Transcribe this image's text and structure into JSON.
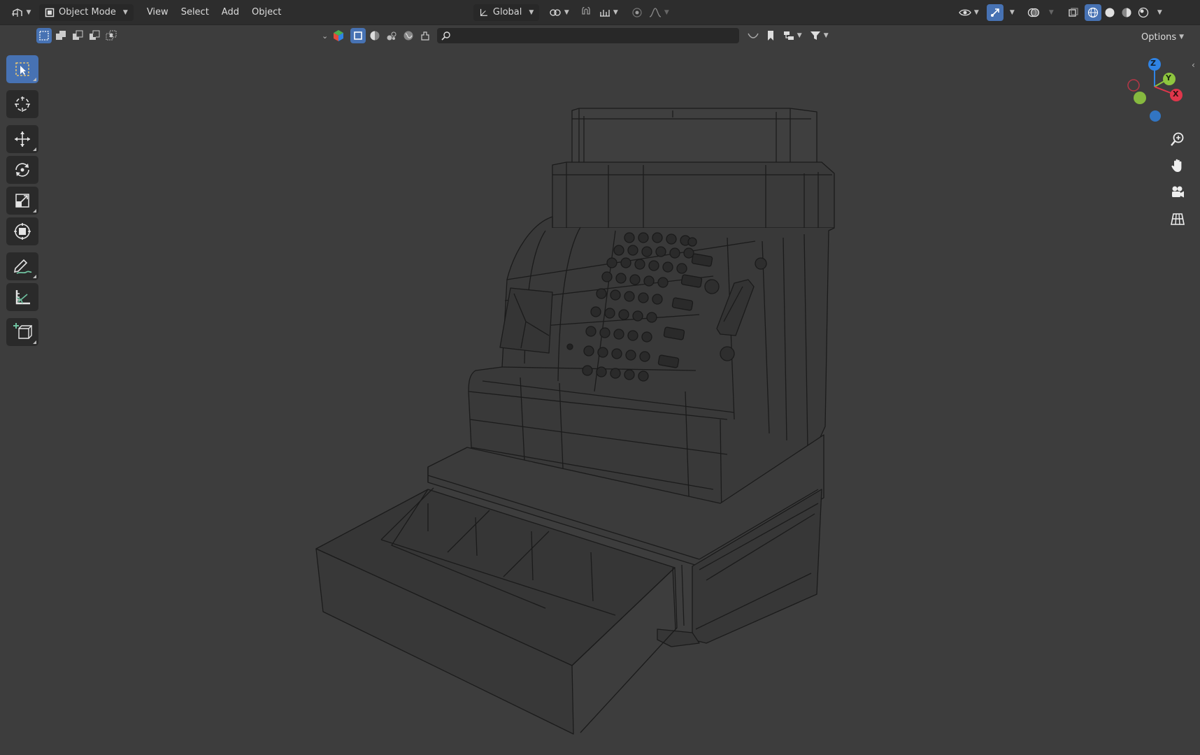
{
  "header": {
    "editor_type_icon": "viewport-editor-icon",
    "mode": "Object Mode",
    "menu": [
      "View",
      "Select",
      "Add",
      "Object"
    ],
    "transform_orientation": "Global",
    "options_label": "Options"
  },
  "subheader": {
    "select_modes": [
      "select-box-new",
      "select-box-extend",
      "select-box-subtract",
      "select-box-invert",
      "select-box-intersect"
    ],
    "search": {
      "value": "",
      "placeholder": ""
    }
  },
  "toolbar": {
    "tools": [
      {
        "name": "select-box-tool",
        "icon": "cursor-select-icon",
        "active": true
      },
      {
        "name": "cursor-tool",
        "icon": "3d-cursor-icon",
        "active": false
      },
      {
        "name": "move-tool",
        "icon": "move-arrows-icon",
        "active": false
      },
      {
        "name": "rotate-tool",
        "icon": "rotate-icon",
        "active": false
      },
      {
        "name": "scale-tool",
        "icon": "scale-icon",
        "active": false
      },
      {
        "name": "transform-tool",
        "icon": "transform-icon",
        "active": false
      },
      {
        "name": "annotate-tool",
        "icon": "pencil-annotate-icon",
        "active": false
      },
      {
        "name": "measure-tool",
        "icon": "ruler-measure-icon",
        "active": false
      },
      {
        "name": "add-cube-tool",
        "icon": "add-cube-icon",
        "active": false
      }
    ]
  },
  "gizmo": {
    "axis_z": "Z",
    "axis_y": "Y",
    "axis_x": "X",
    "colors": {
      "x": "#e0364b",
      "y": "#8ec63f",
      "z": "#2f83e4"
    }
  },
  "navigation": [
    "zoom-icon",
    "pan-hand-icon",
    "camera-view-icon",
    "ortho-grid-icon"
  ],
  "colors": {
    "accent": "#4772b3",
    "viewport_bg": "#3d3d3d",
    "header_bg": "#2d2d2d",
    "wire": "#1a1a1a"
  }
}
